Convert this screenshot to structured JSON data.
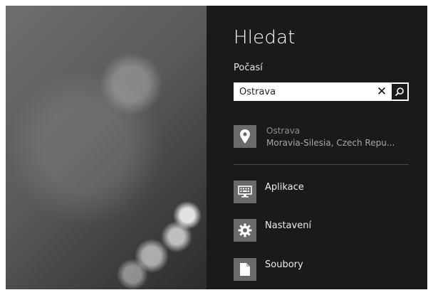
{
  "search_pane": {
    "title": "Hledat",
    "scope": "Počasí",
    "query": "Ostrava",
    "clear_icon": "close-icon",
    "search_icon": "magnifier-icon"
  },
  "suggestion": {
    "icon": "location-pin-icon",
    "line1": "Ostrava",
    "line2": "Moravia-Silesia, Czech Repu..."
  },
  "categories": [
    {
      "label": "Aplikace",
      "icon": "keyboard-icon"
    },
    {
      "label": "Nastavení",
      "icon": "gear-icon"
    },
    {
      "label": "Soubory",
      "icon": "file-icon"
    }
  ],
  "colors": {
    "panel": "#1a1a1a",
    "tile": "#6a6a6a",
    "text": "#ffffff",
    "muted_text": "#8f8f8f"
  }
}
